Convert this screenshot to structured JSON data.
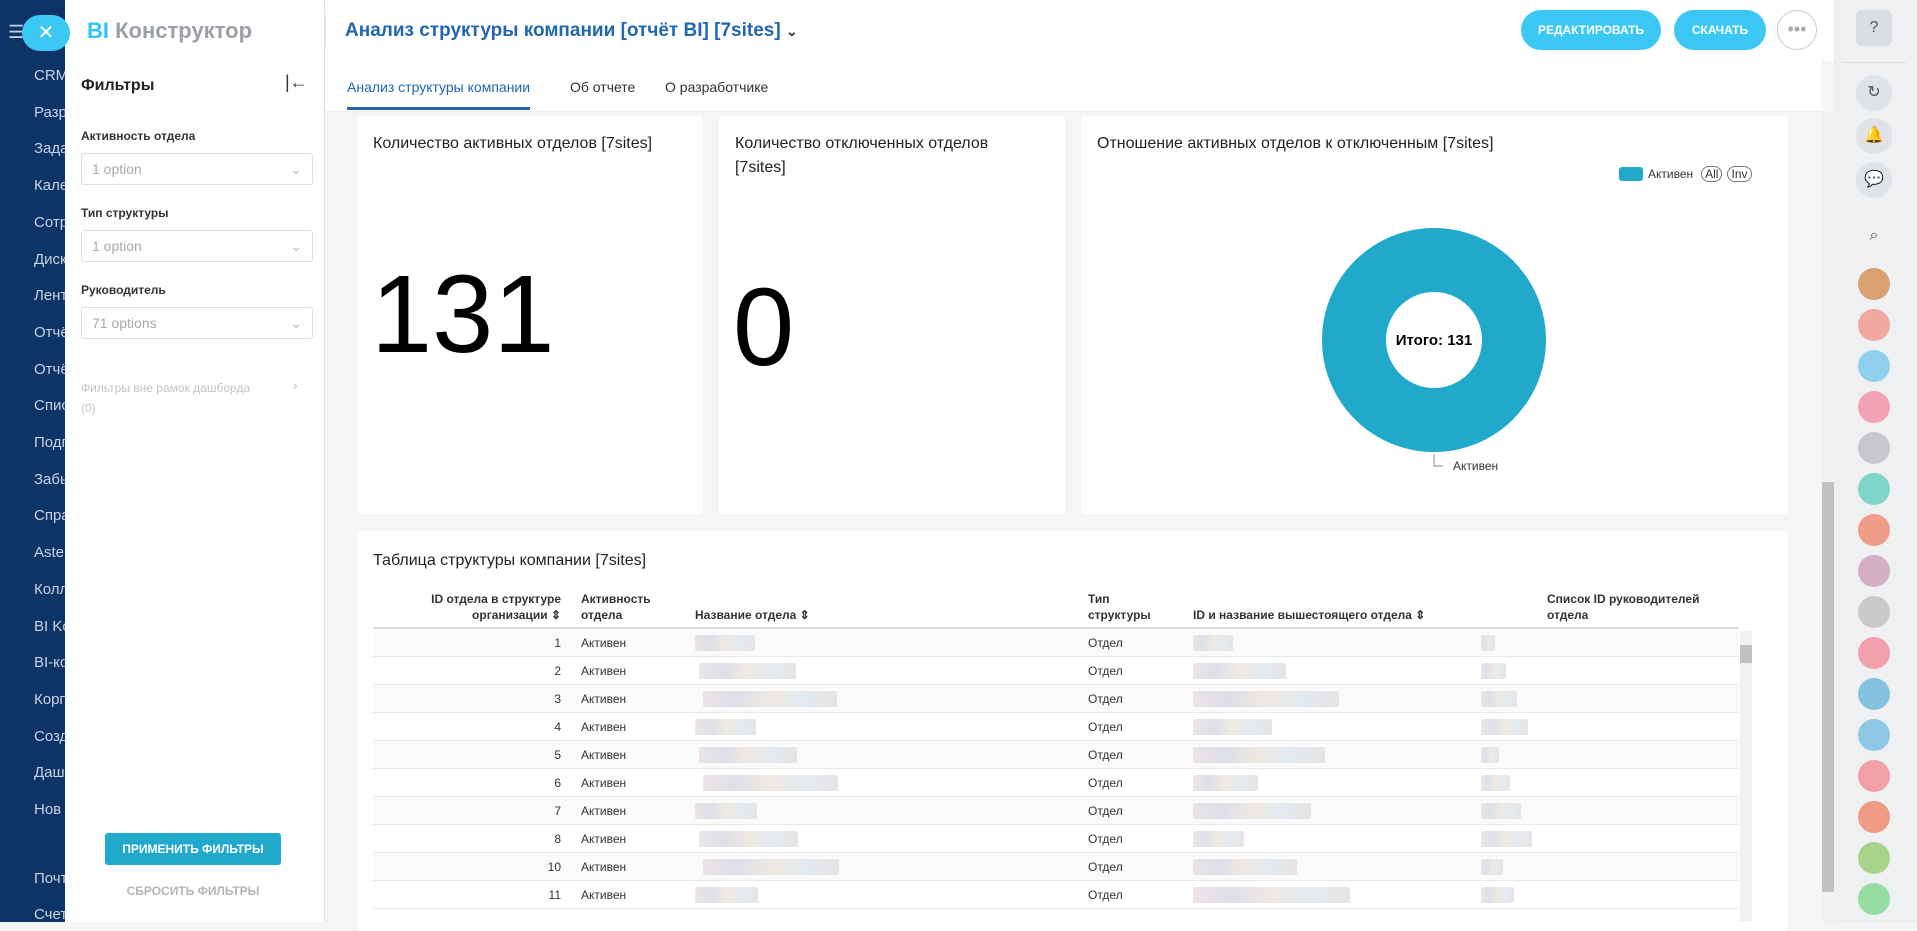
{
  "nav": {
    "items": [
      "CRM",
      "Разр",
      "Зада",
      "Кале",
      "Сотр",
      "Диск",
      "Лент",
      "Отчё",
      "Отчё",
      "Спис",
      "Подг",
      "Забы",
      "Спра",
      "Aster",
      "Колл",
      "BI Ko",
      "BI-ко",
      "Корп",
      "Созд",
      "Даш",
      "Нов",
      "Почт",
      "Счет"
    ]
  },
  "filters": {
    "logo_bi": "BI",
    "logo_text": "Конструктор",
    "title": "Фильтры",
    "fields": [
      {
        "label": "Активность отдела",
        "value": "1 option"
      },
      {
        "label": "Тип структуры",
        "value": "1 option"
      },
      {
        "label": "Руководитель",
        "value": "71 options"
      }
    ],
    "outside": "Фильтры вне рамок дашборда",
    "outside_count": "(0)",
    "apply": "ПРИМЕНИТЬ ФИЛЬТРЫ",
    "reset": "СБРОСИТЬ ФИЛЬТРЫ"
  },
  "header": {
    "title": "Анализ структуры компании [отчёт BI] [7sites]",
    "edit": "РЕДАКТИРОВАТЬ",
    "download": "СКАЧАТЬ"
  },
  "tabs": [
    "Анализ структуры компании",
    "Об отчете",
    "О разработчике"
  ],
  "cards": {
    "active": {
      "title": "Количество активных отделов [7sites]",
      "value": "131"
    },
    "disabled": {
      "title": "Количество отключенных отделов [7sites]",
      "value": "0"
    },
    "ratio": {
      "title": "Отношение активных отделов к отключенным [7sites]",
      "legend": "Активен",
      "all": "All",
      "inv": "Inv",
      "center": "Итого: 131",
      "label": "Активен"
    }
  },
  "colors": {
    "accent": "#20a9cb",
    "brand": "#3bc8f5"
  },
  "chart_data": {
    "type": "pie",
    "title": "Отношение активных отделов к отключенным [7sites]",
    "categories": [
      "Активен"
    ],
    "values": [
      131
    ],
    "total": 131,
    "legend": "top-right"
  },
  "table": {
    "title": "Таблица структуры компании [7sites]",
    "headers": [
      "ID отдела в структуре организации",
      "Активность отдела",
      "Название отдела",
      "Тип структуры",
      "ID и название вышестоящего отдела",
      "Список ID руководителей отдела"
    ],
    "rows": [
      [
        "1",
        "Активен",
        "Отдел"
      ],
      [
        "2",
        "Активен",
        "Отдел"
      ],
      [
        "3",
        "Активен",
        "Отдел"
      ],
      [
        "4",
        "Активен",
        "Отдел"
      ],
      [
        "5",
        "Активен",
        "Отдел"
      ],
      [
        "6",
        "Активен",
        "Отдел"
      ],
      [
        "7",
        "Активен",
        "Отдел"
      ],
      [
        "8",
        "Активен",
        "Отдел"
      ],
      [
        "10",
        "Активен",
        "Отдел"
      ],
      [
        "11",
        "Активен",
        "Отдел"
      ]
    ]
  }
}
